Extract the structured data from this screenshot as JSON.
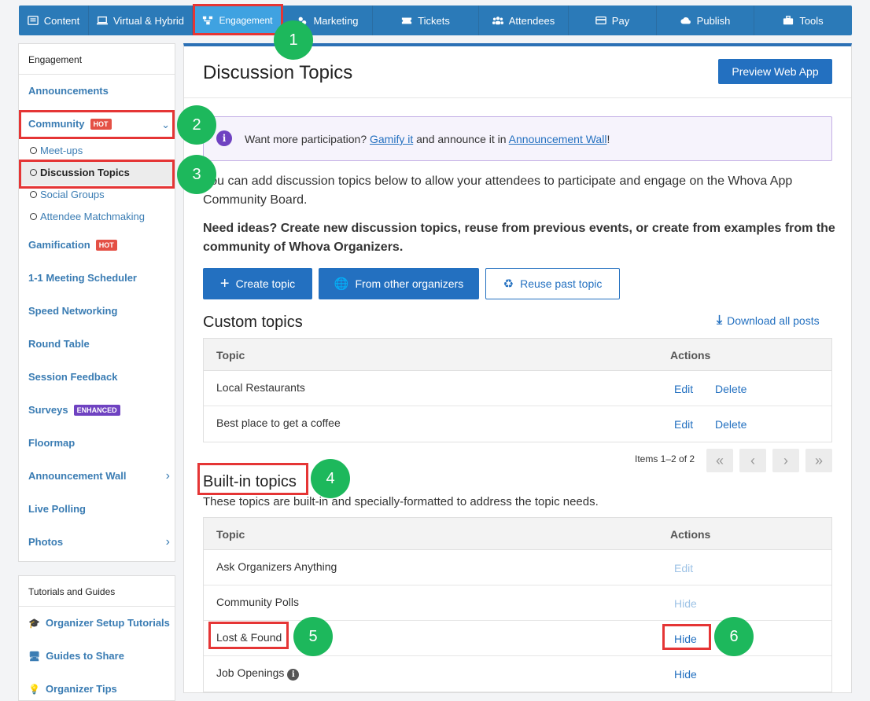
{
  "nav": {
    "tabs": [
      {
        "label": "Content",
        "icon": "content-icon"
      },
      {
        "label": "Virtual & Hybrid",
        "icon": "monitor-icon"
      },
      {
        "label": "Engagement",
        "icon": "engagement-icon"
      },
      {
        "label": "Marketing",
        "icon": "marketing-icon"
      },
      {
        "label": "Tickets",
        "icon": "ticket-icon"
      },
      {
        "label": "Attendees",
        "icon": "attendees-icon"
      },
      {
        "label": "Pay",
        "icon": "card-icon"
      },
      {
        "label": "Publish",
        "icon": "cloud-upload-icon"
      },
      {
        "label": "Tools",
        "icon": "briefcase-icon"
      }
    ],
    "active": "Engagement"
  },
  "sidebar": {
    "title": "Engagement",
    "items": [
      {
        "label": "Announcements"
      },
      {
        "label": "Community",
        "badge": "HOT"
      },
      {
        "label": "Gamification",
        "badge": "HOT"
      },
      {
        "label": "1-1 Meeting Scheduler"
      },
      {
        "label": "Speed Networking"
      },
      {
        "label": "Round Table"
      },
      {
        "label": "Session Feedback"
      },
      {
        "label": "Surveys",
        "badge": "ENHANCED"
      },
      {
        "label": "Floormap"
      },
      {
        "label": "Announcement Wall"
      },
      {
        "label": "Live Polling"
      },
      {
        "label": "Photos"
      }
    ],
    "community_sub": [
      "Meet-ups",
      "Discussion Topics",
      "Social Groups",
      "Attendee Matchmaking"
    ]
  },
  "tutorials": {
    "title": "Tutorials and Guides",
    "items": [
      "Organizer Setup Tutorials",
      "Guides to Share",
      "Organizer Tips"
    ]
  },
  "main": {
    "title": "Discussion Topics",
    "preview_button": "Preview Web App",
    "notice": {
      "prefix": "Want more participation? ",
      "link1": "Gamify it",
      "middle": " and announce it in ",
      "link2": "Announcement Wall",
      "suffix": "!"
    },
    "intro": "You can add discussion topics below to allow your attendees to participate and engage on the Whova App Community Board.",
    "ideas": "Need ideas? Create new discussion topics, reuse from previous events, or create from examples from the community of Whova Organizers.",
    "buttons": {
      "create": "Create topic",
      "from_others": "From other organizers",
      "reuse": "Reuse past topic"
    },
    "custom": {
      "title": "Custom topics",
      "download": "Download all posts",
      "col_topic": "Topic",
      "col_actions": "Actions",
      "rows": [
        {
          "topic": "Local Restaurants",
          "edit": "Edit",
          "delete": "Delete"
        },
        {
          "topic": "Best place to get a coffee",
          "edit": "Edit",
          "delete": "Delete"
        }
      ],
      "pager": "Items 1–2 of 2"
    },
    "builtin": {
      "title": "Built-in topics",
      "desc": "These topics are built-in and specially-formatted to address the topic needs.",
      "col_topic": "Topic",
      "col_actions": "Actions",
      "rows": [
        {
          "topic": "Ask Organizers Anything",
          "action": "Edit"
        },
        {
          "topic": "Community Polls",
          "action": "Hide"
        },
        {
          "topic": "Lost & Found",
          "action": "Hide"
        },
        {
          "topic": "Job Openings",
          "action": "Hide"
        }
      ]
    }
  },
  "annotations": [
    "1",
    "2",
    "3",
    "4",
    "5",
    "6"
  ],
  "colors": {
    "nav": "#2b7ab8",
    "nav_active": "#3fa2e1",
    "primary": "#2370c0",
    "highlight": "#e53535",
    "marker": "#1db85c"
  }
}
